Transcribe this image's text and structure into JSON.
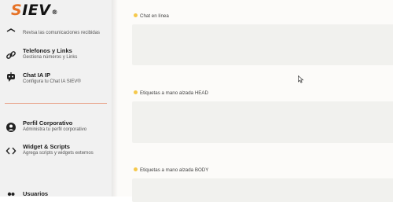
{
  "brand": {
    "logo_s": "S",
    "logo_rest": "IEV",
    "logo_mark": "®"
  },
  "sidebar": {
    "items": [
      {
        "title": "",
        "subtitle": "Revisa las comunicaciones recibidas",
        "icon": "chat-icon"
      },
      {
        "title": "Telefonos y Links",
        "subtitle": "Gestiona números y Links",
        "icon": "link-icon"
      },
      {
        "title": "Chat IA IP",
        "subtitle": "Configura tu Chat IA SIEV®",
        "icon": "robot-chat-icon"
      },
      {
        "title": "Perfil Corporativo",
        "subtitle": "Administra tu perfil corporativo",
        "icon": "profile-icon"
      },
      {
        "title": "Widget & Scripts",
        "subtitle": "Agrega scripts y widgets externos",
        "icon": "code-icon"
      },
      {
        "title": "Usuarios",
        "subtitle": "",
        "icon": "users-icon"
      }
    ]
  },
  "main": {
    "sections": [
      {
        "label": "Chat en línea"
      },
      {
        "label": "Etiquetas a mano alzada HEAD"
      },
      {
        "label": "Etiquetas a mano alzada BODY"
      }
    ]
  },
  "colors": {
    "accent": "#e67226",
    "dot": "#f5c84b",
    "divider": "#e9a58d"
  }
}
